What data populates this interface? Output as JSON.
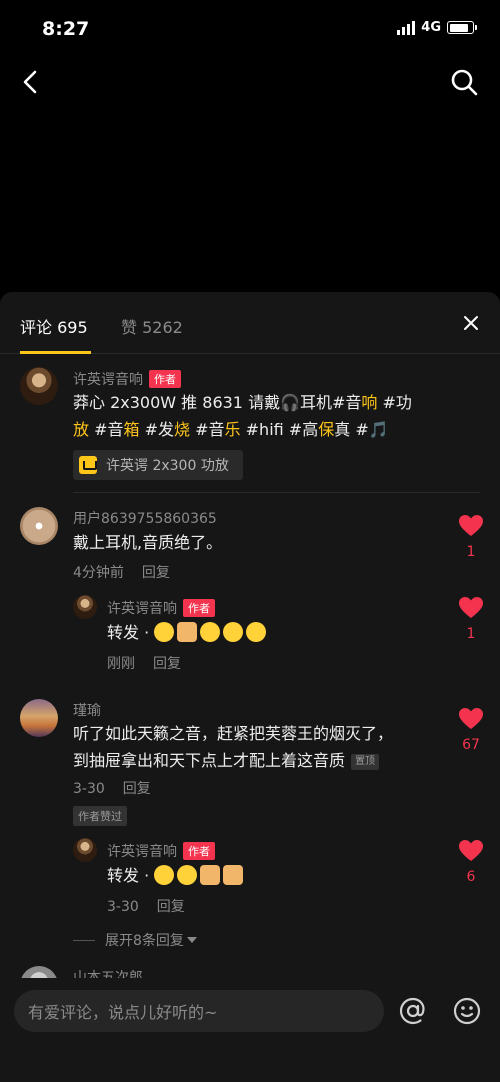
{
  "status": {
    "time": "8:27",
    "network": "4G"
  },
  "tabs": {
    "comments": "评论 695",
    "likes": "赞 5262"
  },
  "post": {
    "author": "许英谔音响",
    "author_tag": "作者",
    "text_line1": [
      "莽心 2x300W 推 8631 请戴🎧耳机#音",
      "响",
      " #功"
    ],
    "text_line2": [
      "放",
      " #音",
      "箱",
      " #发",
      "烧",
      " #音",
      "乐",
      " #hifi #高",
      "保",
      "真",
      " #🎵"
    ],
    "product": "许英谔 2x300 功放"
  },
  "comments": [
    {
      "user": "用户8639755860365",
      "text": "戴上耳机,音质绝了。",
      "time": "4分钟前",
      "reply": "回复",
      "likes": "1",
      "sub": {
        "user": "许英谔音响",
        "tag": "作者",
        "text": "转发 · ",
        "time": "刚刚",
        "reply": "回复",
        "likes": "1"
      }
    },
    {
      "user": "瑾瑜",
      "text_line1": "听了如此天籁之音，赶紧把芙蓉王的烟灭了，",
      "text_line2": "到抽屉拿出和天下点上才配上着这音质",
      "pin": "置顶",
      "time": "3-30",
      "reply": "回复",
      "praised": "作者赞过",
      "likes": "67",
      "sub": {
        "user": "许英谔音响",
        "tag": "作者",
        "text": "转发 · ",
        "time": "3-30",
        "reply": "回复",
        "likes": "6"
      },
      "expand": "展开8条回复"
    },
    {
      "user": "山本五次郎"
    }
  ],
  "input": {
    "placeholder": "有爱评论，说点儿好听的~"
  },
  "colors": {
    "accent": "#ffc61a",
    "like": "#f4344e",
    "panel": "#161616"
  }
}
